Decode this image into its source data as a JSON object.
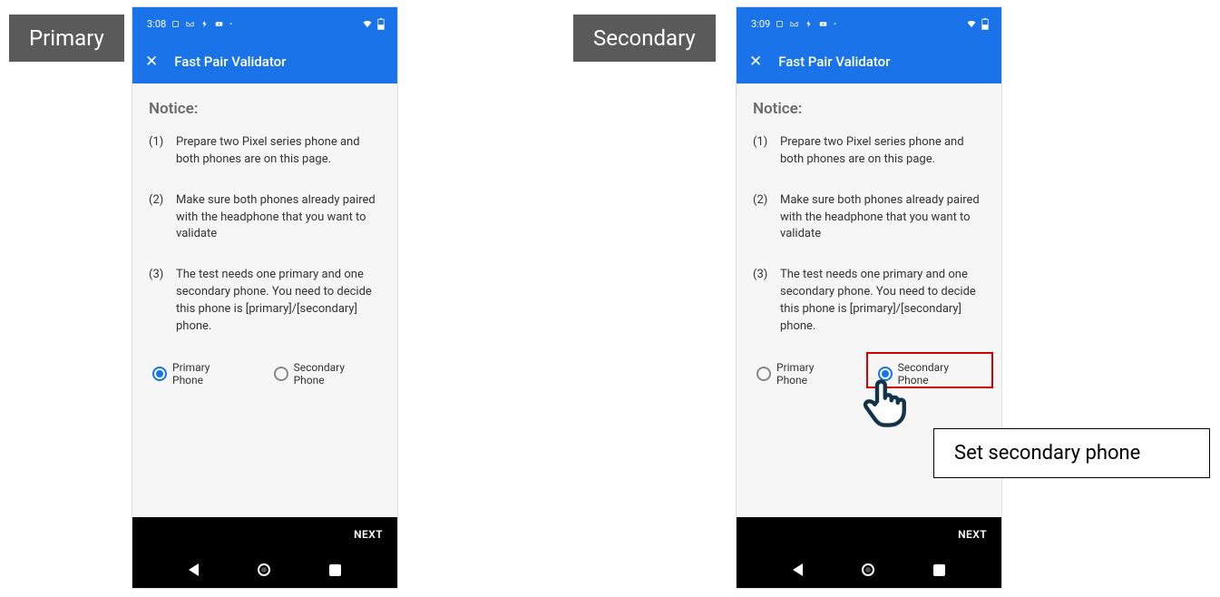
{
  "tags": {
    "primary": "Primary",
    "secondary": "Secondary"
  },
  "callout": "Set secondary phone",
  "phones": [
    {
      "time": "3:08",
      "app_title": "Fast Pair Validator",
      "notice_heading": "Notice:",
      "steps": [
        {
          "num": "(1)",
          "text": "Prepare two Pixel series phone and both phones are on this page."
        },
        {
          "num": "(2)",
          "text": "Make sure both phones already paired with the headphone that you want to validate"
        },
        {
          "num": "(3)",
          "text": "The test needs one primary and one secondary phone. You need to decide this phone is [primary]/[secondary] phone."
        }
      ],
      "radios": {
        "primary_label": "Primary Phone",
        "secondary_label": "Secondary Phone",
        "selected": "primary"
      },
      "next": "NEXT"
    },
    {
      "time": "3:09",
      "app_title": "Fast Pair Validator",
      "notice_heading": "Notice:",
      "steps": [
        {
          "num": "(1)",
          "text": "Prepare two Pixel series phone and both phones are on this page."
        },
        {
          "num": "(2)",
          "text": "Make sure both phones already paired with the headphone that you want to validate"
        },
        {
          "num": "(3)",
          "text": "The test needs one primary and one secondary phone. You need to decide this phone is [primary]/[secondary] phone."
        }
      ],
      "radios": {
        "primary_label": "Primary Phone",
        "secondary_label": "Secondary Phone",
        "selected": "secondary"
      },
      "next": "NEXT"
    }
  ]
}
